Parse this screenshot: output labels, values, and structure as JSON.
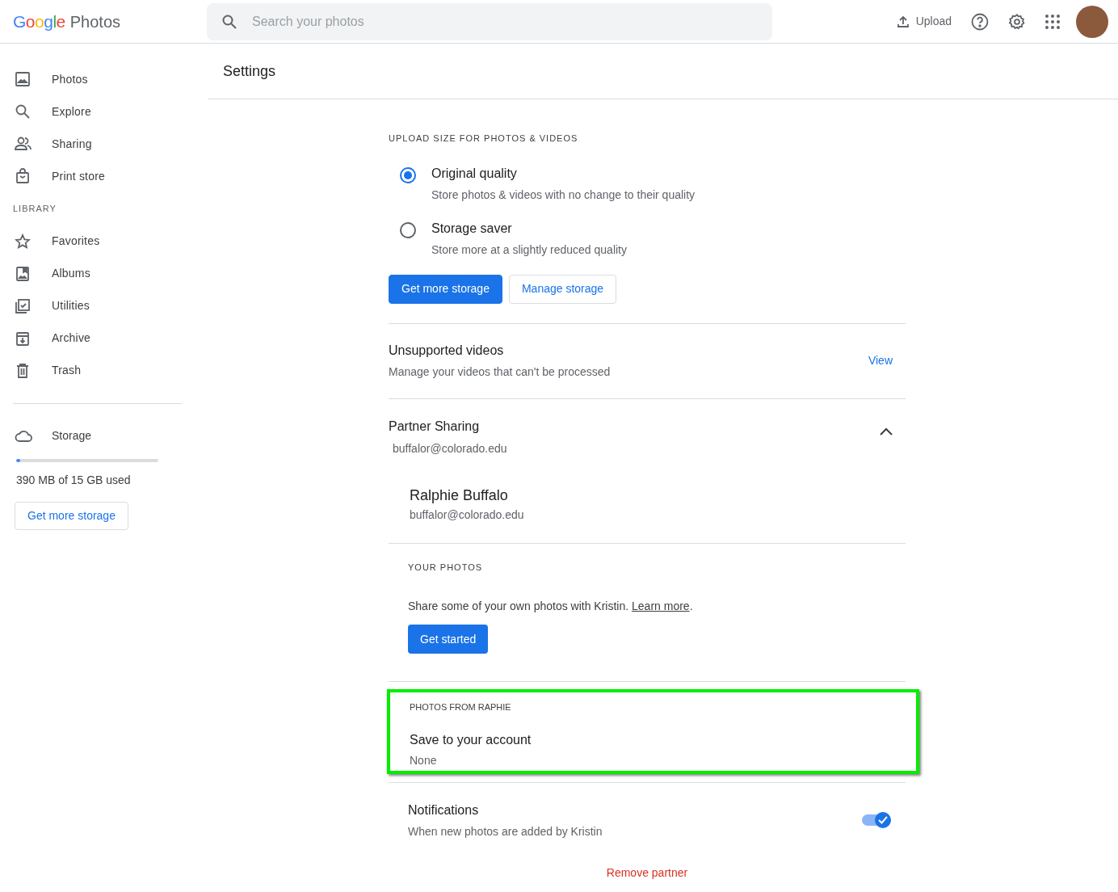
{
  "app": {
    "logo_word": "Google",
    "logo_product": "Photos"
  },
  "search": {
    "placeholder": "Search your photos"
  },
  "header_actions": {
    "upload": "Upload"
  },
  "sidebar": {
    "items": [
      {
        "label": "Photos",
        "selected": false
      },
      {
        "label": "Explore",
        "selected": false
      },
      {
        "label": "Sharing",
        "selected": false
      },
      {
        "label": "Print store",
        "selected": false
      }
    ],
    "library_heading": "LIBRARY",
    "library_items": [
      {
        "label": "Favorites",
        "selected": false
      },
      {
        "label": "Albums",
        "selected": false
      },
      {
        "label": "Utilities",
        "selected": false
      },
      {
        "label": "Archive",
        "selected": false
      },
      {
        "label": "Trash",
        "selected": false
      }
    ],
    "storage": {
      "label": "Storage",
      "level": 0.026,
      "usage": "390 MB of 15 GB used",
      "button": "Get more storage"
    }
  },
  "page_title": "Settings",
  "upload_size": {
    "heading": "UPLOAD SIZE FOR PHOTOS & VIDEOS",
    "options": [
      {
        "title": "Original quality",
        "description": "Store photos & videos with no change to their quality",
        "selected": true
      },
      {
        "title": "Storage saver",
        "description": "Store more at a slightly reduced quality",
        "selected": false
      }
    ],
    "buttons": [
      {
        "label": "Get more storage",
        "kind": "primary"
      },
      {
        "label": "Manage storage",
        "kind": "outline"
      }
    ]
  },
  "unsupported_videos": {
    "title": "Unsupported videos",
    "description": "Manage your videos that can't be processed",
    "link": "View"
  },
  "partner_sharing": {
    "title": "Partner Sharing",
    "email": "buffalor@colorado.edu",
    "expanded": true,
    "partner": {
      "name": "Ralphie Buffalo",
      "email": "buffalor@colorado.edu"
    },
    "your_photos": {
      "heading": "YOUR PHOTOS",
      "text": "Share some of your own photos with Kristin. ",
      "link": "Learn more",
      "after": ".",
      "button": "Get started"
    },
    "photos_from": {
      "heading": "PHOTOS FROM RAPHIE",
      "highlighted": true,
      "title": "Save to your account",
      "value": "None"
    },
    "notifications": {
      "title": "Notifications",
      "description": "When new photos are added by Kristin",
      "on": true
    },
    "remove": "Remove partner"
  }
}
